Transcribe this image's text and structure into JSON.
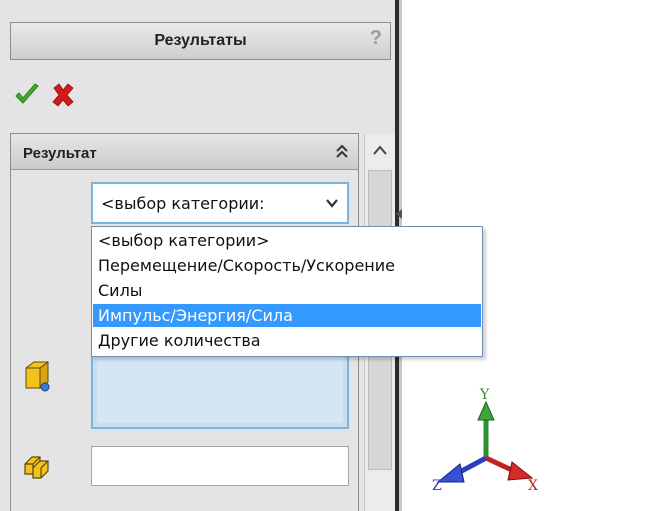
{
  "panel": {
    "title": "Результаты",
    "help_label": "?",
    "ok_icon": "checkmark-icon",
    "cancel_icon": "close-icon"
  },
  "section": {
    "label": "Результат",
    "collapse_icon": "double-chevron-up-icon"
  },
  "combo": {
    "value": "<выбор категории:",
    "chevron_icon": "chevron-down-icon"
  },
  "dropdown": {
    "options": [
      "<выбор категории>",
      "Перемещение/Скорость/Ускорение",
      "Силы",
      "Импульс/Энергия/Сила",
      "Другие количества"
    ],
    "selected_index": 3
  },
  "triad": {
    "x_label": "X",
    "y_label": "Y",
    "z_label": "Z"
  },
  "colors": {
    "accent": "#3399ff",
    "field_border": "#78b5e3",
    "ok_green": "#3fae2a",
    "cancel_red": "#d51818"
  }
}
